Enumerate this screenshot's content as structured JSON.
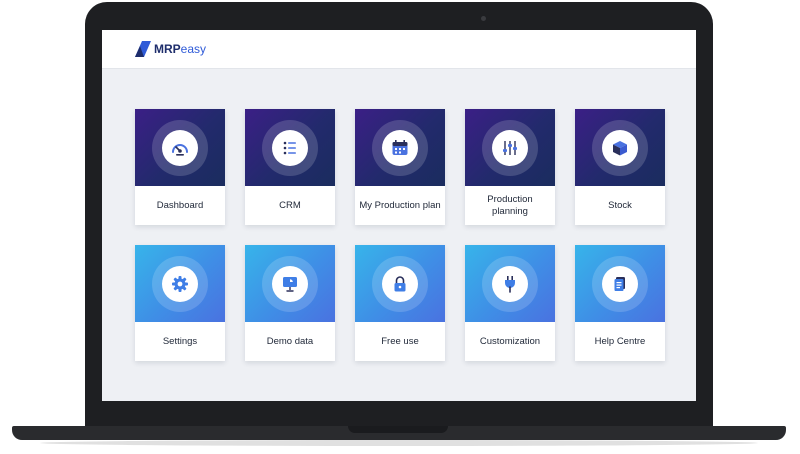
{
  "app": {
    "logo_bold": "MRP",
    "logo_light": "easy"
  },
  "tiles": [
    {
      "label": "Dashboard",
      "icon": "gauge-icon"
    },
    {
      "label": "CRM",
      "icon": "list-icon"
    },
    {
      "label": "My Production plan",
      "icon": "calendar-icon"
    },
    {
      "label": "Production planning",
      "icon": "sliders-icon"
    },
    {
      "label": "Stock",
      "icon": "box-icon"
    },
    {
      "label": "Settings",
      "icon": "gear-icon"
    },
    {
      "label": "Demo data",
      "icon": "presentation-icon"
    },
    {
      "label": "Free use",
      "icon": "lock-icon"
    },
    {
      "label": "Customization",
      "icon": "plug-icon"
    },
    {
      "label": "Help Centre",
      "icon": "document-icon"
    }
  ],
  "colors": {
    "row1_gradient": [
      "#3b1f86",
      "#1a2c5e"
    ],
    "row2_gradient": [
      "#37b4ea",
      "#4a72e0"
    ],
    "brand_dark": "#1e2d6b",
    "brand_light": "#2f5bd8"
  }
}
